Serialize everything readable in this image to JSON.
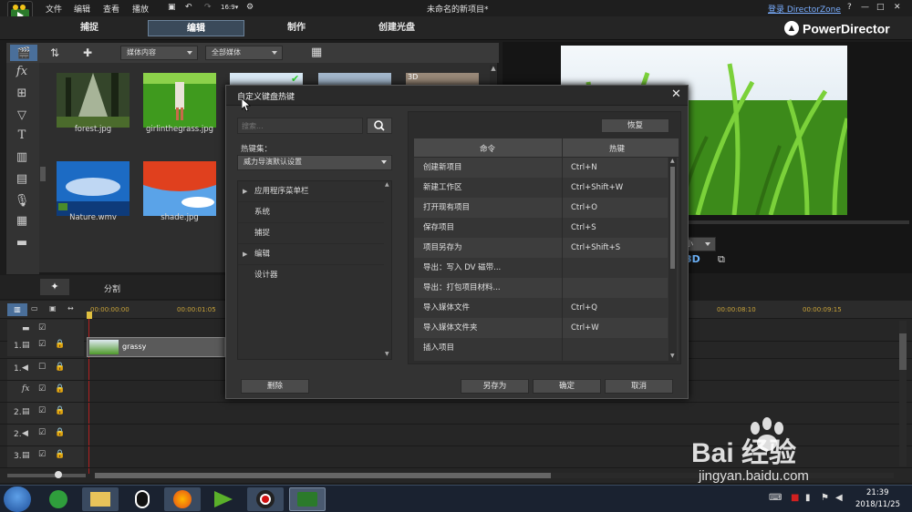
{
  "app": {
    "window_title": "未命名的新项目*",
    "login_link": "登录 DirectorZone",
    "brand": "PowerDirector",
    "menu": [
      "文件",
      "编辑",
      "查看",
      "播放"
    ],
    "window_controls": [
      "?",
      "—",
      "□",
      "✕"
    ]
  },
  "modes": [
    "捕捉",
    "编辑",
    "制作",
    "创建光盘"
  ],
  "library": {
    "filter1": "媒体内容",
    "filter2": "全部媒体",
    "thumbnails": [
      {
        "name": "forest.jpg"
      },
      {
        "name": "girlinthegrass.jpg"
      },
      {
        "name": "Nature.wmv"
      },
      {
        "name": "shade.jpg"
      }
    ],
    "partial_badge": "3D"
  },
  "preview": {
    "size_select": "小",
    "three_d": "3D"
  },
  "split_label": "分割",
  "timeline": {
    "timecodes": [
      "00:00:00:00",
      "00:00:01:05",
      "00:00:08:10",
      "00:00:09:15"
    ],
    "clip_name": "grassy",
    "tracks": [
      "1.",
      "1.",
      "2.",
      "2.",
      "3."
    ]
  },
  "dialog": {
    "title": "自定义键盘热键",
    "search_placeholder": "搜索...",
    "restore_button": "恢复",
    "hotkey_set_label": "热键集：",
    "hotkey_set_value": "威力导演默认设置",
    "categories": [
      {
        "label": "应用程序菜单栏",
        "expandable": true
      },
      {
        "label": "系统",
        "expandable": false
      },
      {
        "label": "捕捉",
        "expandable": false
      },
      {
        "label": "编辑",
        "expandable": true
      },
      {
        "label": "设计器",
        "expandable": false
      }
    ],
    "columns": {
      "command": "命令",
      "hotkey": "热键"
    },
    "rows": [
      {
        "command": "创建新项目",
        "hotkey": "Ctrl+N"
      },
      {
        "command": "新建工作区",
        "hotkey": "Ctrl+Shift+W"
      },
      {
        "command": "打开现有项目",
        "hotkey": "Ctrl+O"
      },
      {
        "command": "保存项目",
        "hotkey": "Ctrl+S"
      },
      {
        "command": "项目另存为",
        "hotkey": "Ctrl+Shift+S"
      },
      {
        "command": "导出：写入 DV 磁带...",
        "hotkey": ""
      },
      {
        "command": "导出：打包项目材料...",
        "hotkey": ""
      },
      {
        "command": "导入媒体文件",
        "hotkey": "Ctrl+Q"
      },
      {
        "command": "导入媒体文件夹",
        "hotkey": "Ctrl+W"
      },
      {
        "command": "插入项目",
        "hotkey": ""
      }
    ],
    "delete_button": "删除",
    "save_as_button": "另存为",
    "ok_button": "确定",
    "cancel_button": "取消"
  },
  "taskbar": {
    "time": "21:39",
    "date": "2018/11/25"
  },
  "watermark": {
    "brand": "Bai 经验",
    "url": "jingyan.baidu.com"
  }
}
